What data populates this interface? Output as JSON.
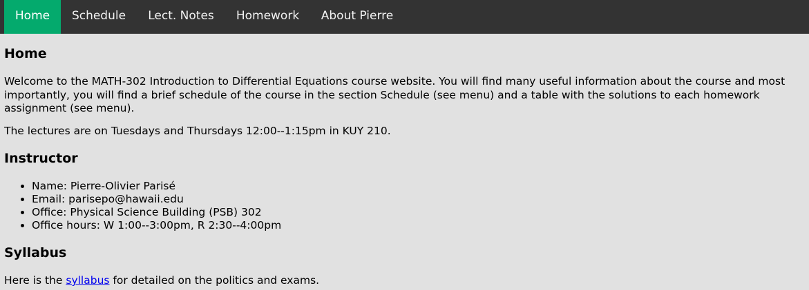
{
  "nav": {
    "items": [
      {
        "label": "Home",
        "active": true
      },
      {
        "label": "Schedule",
        "active": false
      },
      {
        "label": "Lect. Notes",
        "active": false
      },
      {
        "label": "Homework",
        "active": false
      },
      {
        "label": "About Pierre",
        "active": false
      }
    ],
    "colors": {
      "bar": "#333333",
      "active": "#04aa6d",
      "text": "#f2f2f2"
    }
  },
  "home": {
    "heading": "Home",
    "welcome": "Welcome to the MATH-302 Introduction to Differential Equations course website. You will find many useful information about the course and most importantly, you will find a brief schedule of the course in the section Schedule (see menu) and a table with the solutions to each homework assignment (see menu).",
    "lectures": "The lectures are on Tuesdays and Thursdays 12:00--1:15pm in KUY 210."
  },
  "instructor": {
    "heading": "Instructor",
    "items": [
      "Name: Pierre-Olivier Parisé",
      "Email: parisepo@hawaii.edu",
      "Office: Physical Science Building (PSB) 302",
      "Office hours: W 1:00--3:00pm, R 2:30--4:00pm"
    ]
  },
  "syllabus": {
    "heading": "Syllabus",
    "before": "Here is the ",
    "link": "syllabus",
    "after": " for detailed on the politics and exams."
  },
  "page_background": "#e1e1e1",
  "link_color": "#0000ee"
}
